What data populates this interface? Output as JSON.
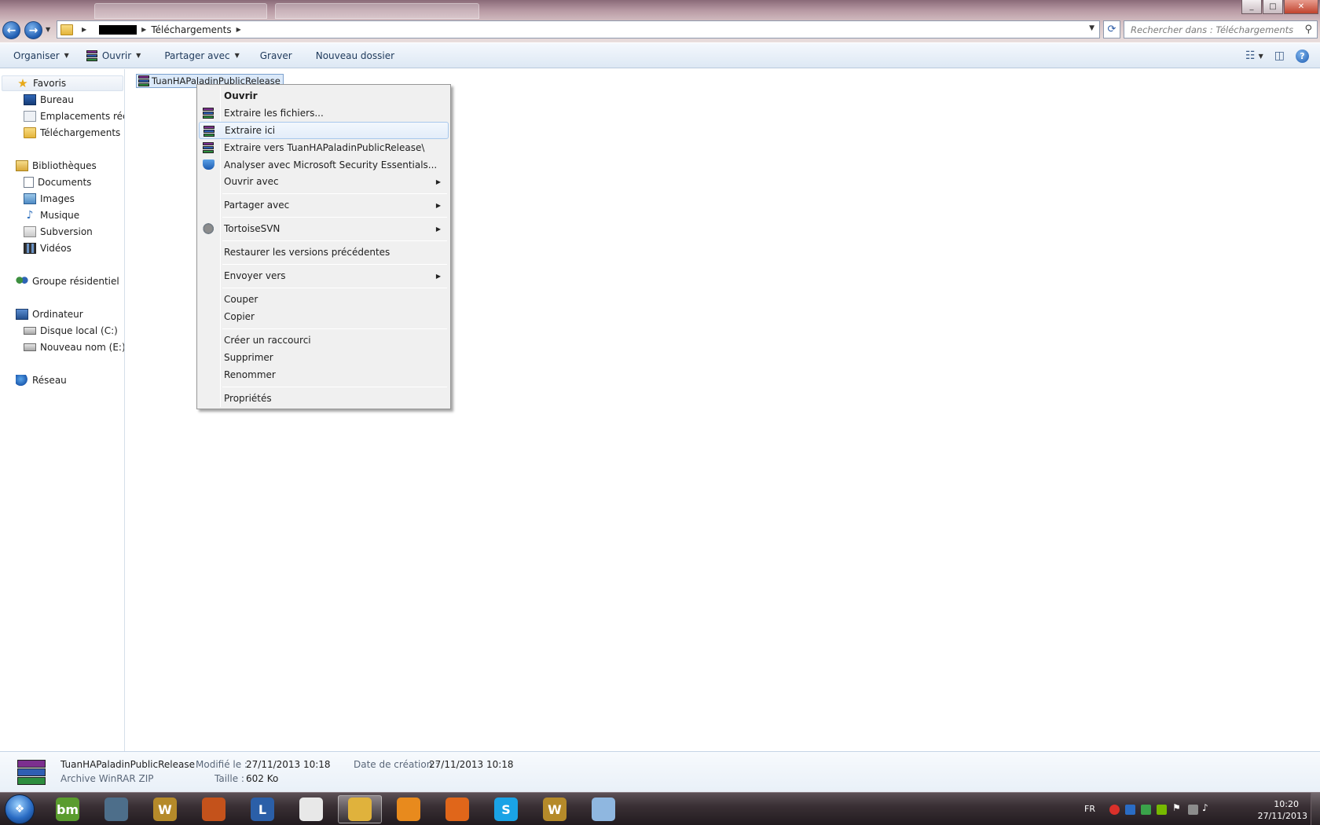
{
  "window": {
    "controls": {
      "minimize": "_",
      "maximize": "□",
      "close": "✕"
    }
  },
  "address": {
    "current_folder": "Téléchargements",
    "search_placeholder": "Rechercher dans : Téléchargements"
  },
  "toolbar": {
    "organize": "Organiser",
    "open": "Ouvrir",
    "share": "Partager avec",
    "burn": "Graver",
    "new_folder": "Nouveau dossier"
  },
  "nav": {
    "favorites": "Favoris",
    "desktop": "Bureau",
    "recent": "Emplacements récents",
    "downloads": "Téléchargements",
    "libraries": "Bibliothèques",
    "documents": "Documents",
    "images": "Images",
    "music": "Musique",
    "subversion": "Subversion",
    "videos": "Vidéos",
    "homegroup": "Groupe résidentiel",
    "computer": "Ordinateur",
    "drive_c": "Disque local (C:)",
    "drive_e": "Nouveau nom (E:)",
    "network": "Réseau"
  },
  "file": {
    "name": "TuanHAPaladinPublicRelease",
    "type": "Archive WinRAR ZIP",
    "modified_label": "Modifié le :",
    "modified_value": "27/11/2013 10:18",
    "size_label": "Taille :",
    "size_value": "602 Ko",
    "created_label": "Date de création :",
    "created_value": "27/11/2013 10:18"
  },
  "context_menu": {
    "open": "Ouvrir",
    "extract_files": "Extraire les fichiers...",
    "extract_here": "Extraire ici",
    "extract_to": "Extraire vers TuanHAPaladinPublicRelease\\",
    "scan": "Analyser avec Microsoft Security Essentials...",
    "open_with": "Ouvrir avec",
    "share_with": "Partager avec",
    "tortoise": "TortoiseSVN",
    "restore": "Restaurer les versions précédentes",
    "send_to": "Envoyer vers",
    "cut": "Couper",
    "copy": "Copier",
    "shortcut": "Créer un raccourci",
    "delete": "Supprimer",
    "rename": "Renommer",
    "properties": "Propriétés",
    "highlighted": "Extraire ici"
  },
  "taskbar": {
    "apps": [
      {
        "label": "bm",
        "color": "#5a9c2e"
      },
      {
        "label": "",
        "color": "#4d6e8a"
      },
      {
        "label": "W",
        "color": "#b58a2a"
      },
      {
        "label": "",
        "color": "#c4521b"
      },
      {
        "label": "L",
        "color": "#2b5fa8"
      },
      {
        "label": "",
        "color": "#e8e8e8"
      },
      {
        "label": "",
        "color": "#e0b23c"
      },
      {
        "label": "",
        "color": "#e88a1d"
      },
      {
        "label": "",
        "color": "#e0661a"
      },
      {
        "label": "S",
        "color": "#1aa3e6"
      },
      {
        "label": "W",
        "color": "#b58a2a"
      },
      {
        "label": "",
        "color": "#8fb7e0"
      }
    ],
    "lang": "FR",
    "time": "10:20",
    "date": "27/11/2013"
  }
}
